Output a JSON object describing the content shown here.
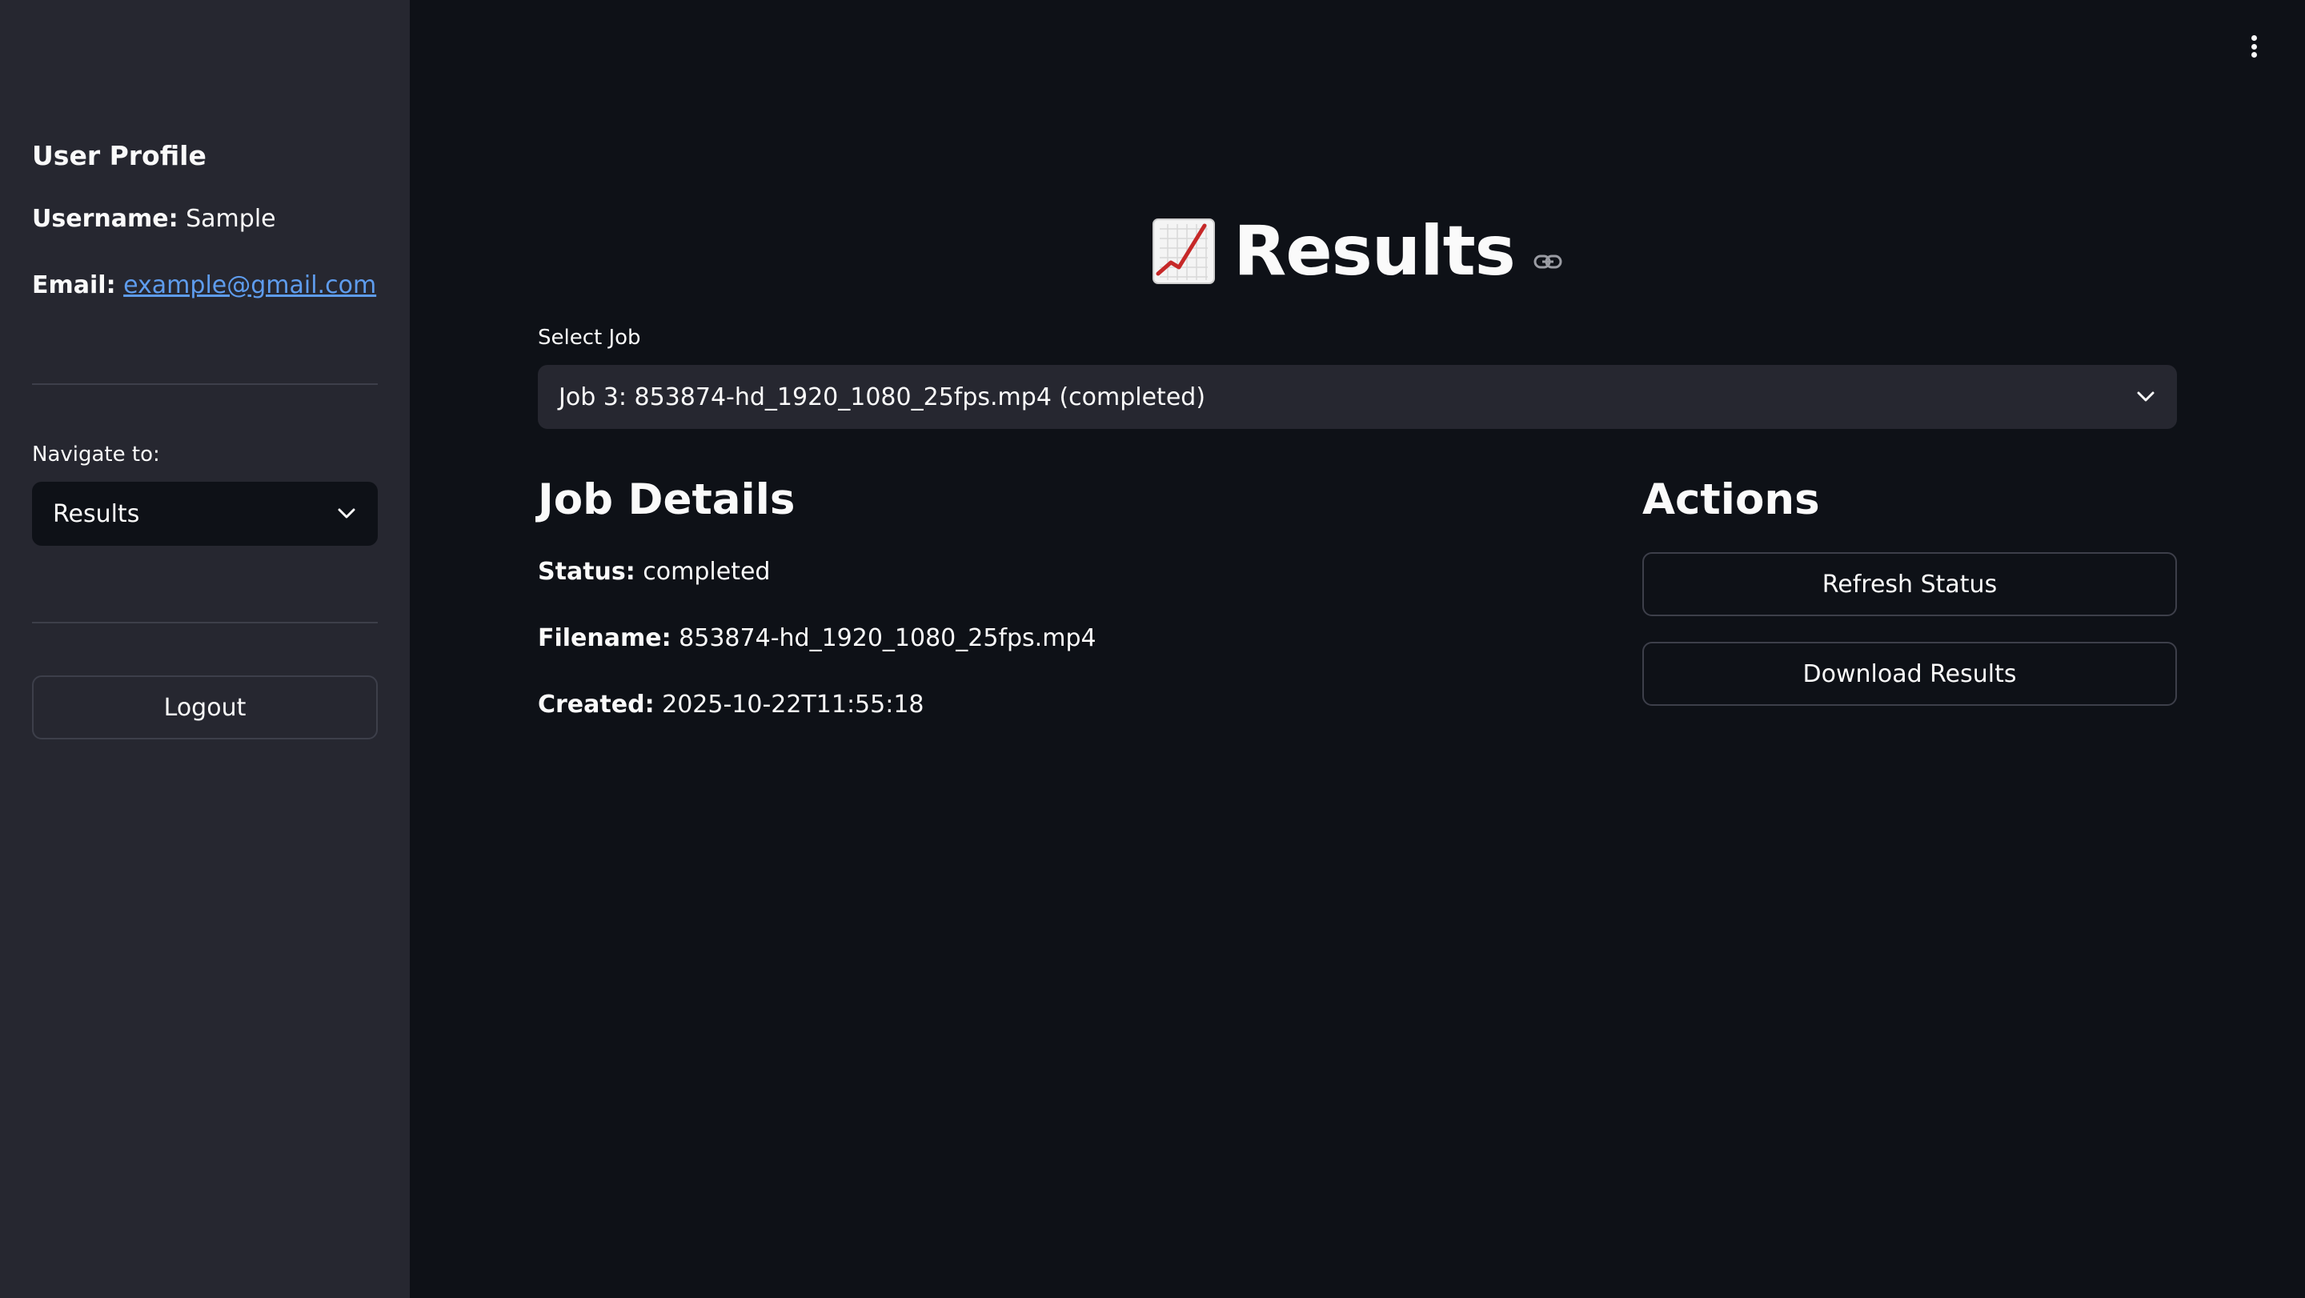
{
  "sidebar": {
    "profile_heading": "User Profile",
    "username_label": "Username:",
    "username_value": "Sample",
    "email_label": "Email:",
    "email_value": "example@gmail.com",
    "nav_label": "Navigate to:",
    "nav_selected": "Results",
    "logout_label": "Logout"
  },
  "header": {
    "menu_icon": "kebab-menu-icon"
  },
  "main": {
    "title_icon": "chart-increasing-icon",
    "title": "Results",
    "anchor_icon": "link-icon",
    "select_job_label": "Select Job",
    "select_job_value": "Job 3: 853874-hd_1920_1080_25fps.mp4 (completed)",
    "job_details_heading": "Job Details",
    "status_label": "Status:",
    "status_value": "completed",
    "filename_label": "Filename:",
    "filename_value": "853874-hd_1920_1080_25fps.mp4",
    "created_label": "Created:",
    "created_value": "2025-10-22T11:55:18",
    "actions_heading": "Actions",
    "refresh_label": "Refresh Status",
    "download_label": "Download Results"
  },
  "colors": {
    "background": "#0e1117",
    "sidebar": "#262730",
    "text": "#fafafa",
    "link": "#5e9ced",
    "border": "#3d3f4a"
  }
}
